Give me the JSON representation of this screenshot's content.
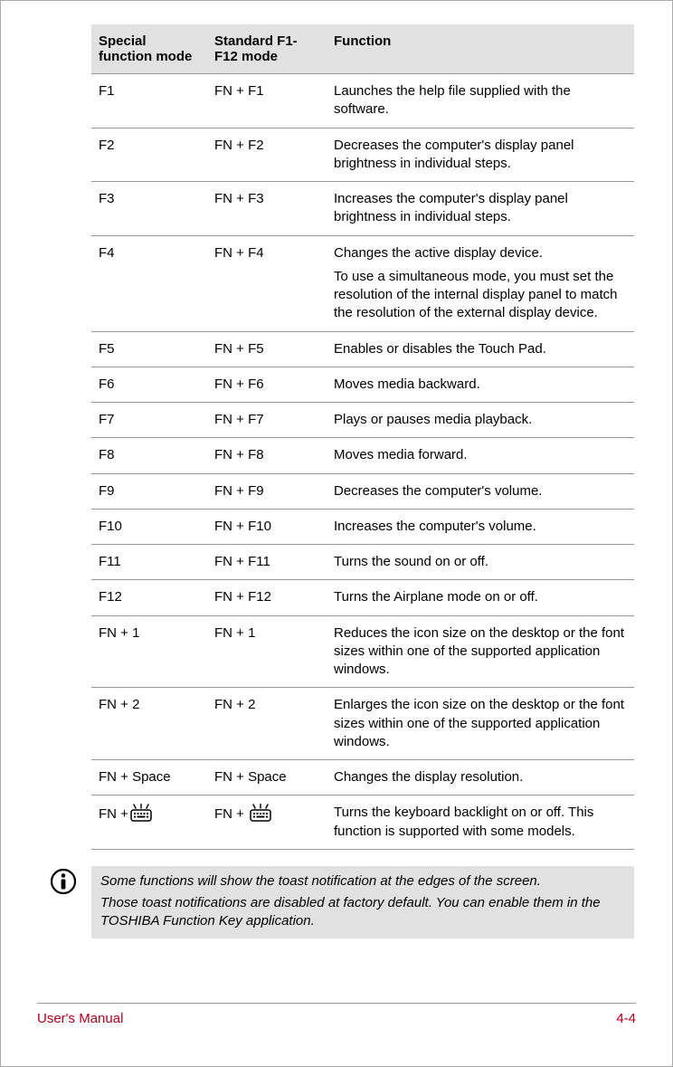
{
  "table": {
    "headers": {
      "col1": "Special function mode",
      "col2": "Standard F1-F12 mode",
      "col3": "Function"
    },
    "rows": [
      {
        "sfm": "F1",
        "std": "FN + F1",
        "func": [
          "Launches the help file supplied with the software."
        ]
      },
      {
        "sfm": "F2",
        "std": "FN + F2",
        "func": [
          "Decreases the computer's display panel brightness in individual steps."
        ]
      },
      {
        "sfm": "F3",
        "std": "FN + F3",
        "func": [
          "Increases the computer's display panel brightness in individual steps."
        ]
      },
      {
        "sfm": "F4",
        "std": "FN + F4",
        "func": [
          "Changes the active display device.",
          "To use a simultaneous mode, you must set the resolution of the internal display panel to match the resolution of the external display device."
        ]
      },
      {
        "sfm": "F5",
        "std": "FN + F5",
        "func": [
          "Enables or disables the Touch Pad."
        ]
      },
      {
        "sfm": "F6",
        "std": "FN + F6",
        "func": [
          "Moves media backward."
        ]
      },
      {
        "sfm": "F7",
        "std": "FN + F7",
        "func": [
          "Plays or pauses media playback."
        ]
      },
      {
        "sfm": "F8",
        "std": "FN + F8",
        "func": [
          "Moves media forward."
        ]
      },
      {
        "sfm": "F9",
        "std": "FN + F9",
        "func": [
          "Decreases the computer's volume."
        ]
      },
      {
        "sfm": "F10",
        "std": "FN + F10",
        "func": [
          "Increases the computer's volume."
        ]
      },
      {
        "sfm": "F11",
        "std": "FN + F11",
        "func": [
          "Turns the sound on or off."
        ]
      },
      {
        "sfm": "F12",
        "std": "FN + F12",
        "func": [
          "Turns the Airplane mode on or off."
        ]
      },
      {
        "sfm": "FN + 1",
        "std": "FN + 1",
        "func": [
          "Reduces the icon size on the desktop or the font sizes within one of the supported application windows."
        ]
      },
      {
        "sfm": "FN + 2",
        "std": "FN + 2",
        "func": [
          "Enlarges the icon size on the desktop or the font sizes within one of the supported application windows."
        ]
      },
      {
        "sfm": "FN + Space",
        "std": "FN + Space",
        "func": [
          "Changes the display resolution."
        ]
      },
      {
        "sfm_prefix": "FN +",
        "sfm_icon": "keyboard-backlight",
        "std_prefix": "FN + ",
        "std_icon": "keyboard-backlight",
        "func": [
          "Turns the keyboard backlight on or off. This function is supported with some models."
        ]
      }
    ]
  },
  "note": {
    "lines": [
      "Some functions will show the toast notification at the edges of the screen.",
      "Those toast notifications are disabled at factory default. You can enable them in the TOSHIBA Function Key application."
    ]
  },
  "footer": {
    "left": "User's Manual",
    "right": "4-4"
  }
}
